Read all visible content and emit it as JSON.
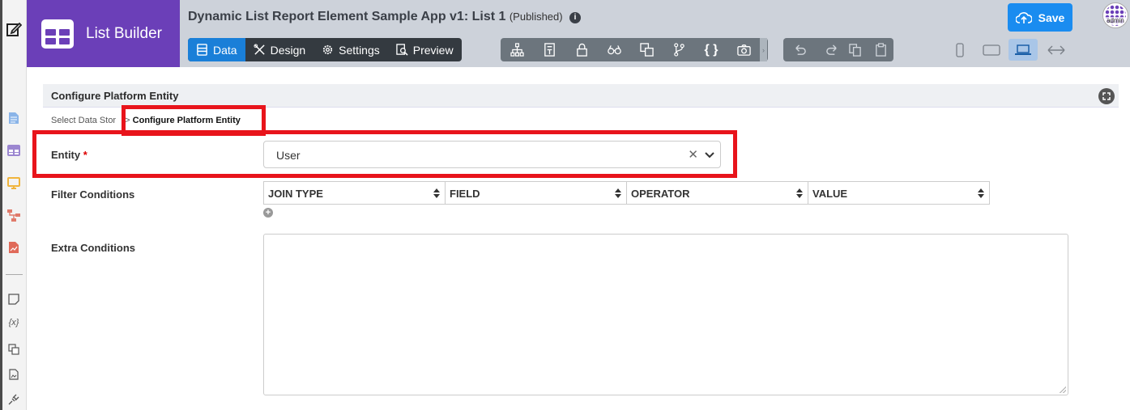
{
  "brand": {
    "title": "List Builder",
    "color": "#6b3fb8"
  },
  "header": {
    "app_title": "Dynamic List Report Element Sample App v1: List 1",
    "status": "(Published)",
    "save_label": "Save"
  },
  "user": {
    "avatar_text": "admin"
  },
  "tabs": [
    {
      "label": "Data",
      "icon": "table-icon",
      "active": true
    },
    {
      "label": "Design",
      "icon": "design-tools-icon"
    },
    {
      "label": "Settings",
      "icon": "gear-icon"
    },
    {
      "label": "Preview",
      "icon": "preview-icon"
    }
  ],
  "tools": [
    "sitemap-icon",
    "form-icon",
    "lock-icon",
    "binoculars-icon",
    "translate-icon",
    "branch-icon",
    "braces-icon",
    "camera-icon"
  ],
  "history_tools": [
    "undo-icon",
    "redo-icon"
  ],
  "clipboard_tools": [
    "copy-icon",
    "paste-icon"
  ],
  "devices": [
    "phone-icon",
    "tablet-icon",
    "laptop-icon",
    "expand-horizontal-icon"
  ],
  "panel": {
    "title": "Configure Platform Entity",
    "breadcrumb_prev": "Select Data Stor",
    "breadcrumb_sep": ">",
    "breadcrumb_current": "Configure Platform Entity"
  },
  "form": {
    "entity_label": "Entity",
    "required_mark": "*",
    "entity_value": "User",
    "filter_label": "Filter Conditions",
    "columns": [
      "JOIN TYPE",
      "FIELD",
      "OPERATOR",
      "VALUE"
    ],
    "extra_label": "Extra Conditions",
    "extra_value": ""
  },
  "colors": {
    "accent": "#1a7fd8",
    "save": "#1a8cf0",
    "highlight": "#e8141b"
  }
}
